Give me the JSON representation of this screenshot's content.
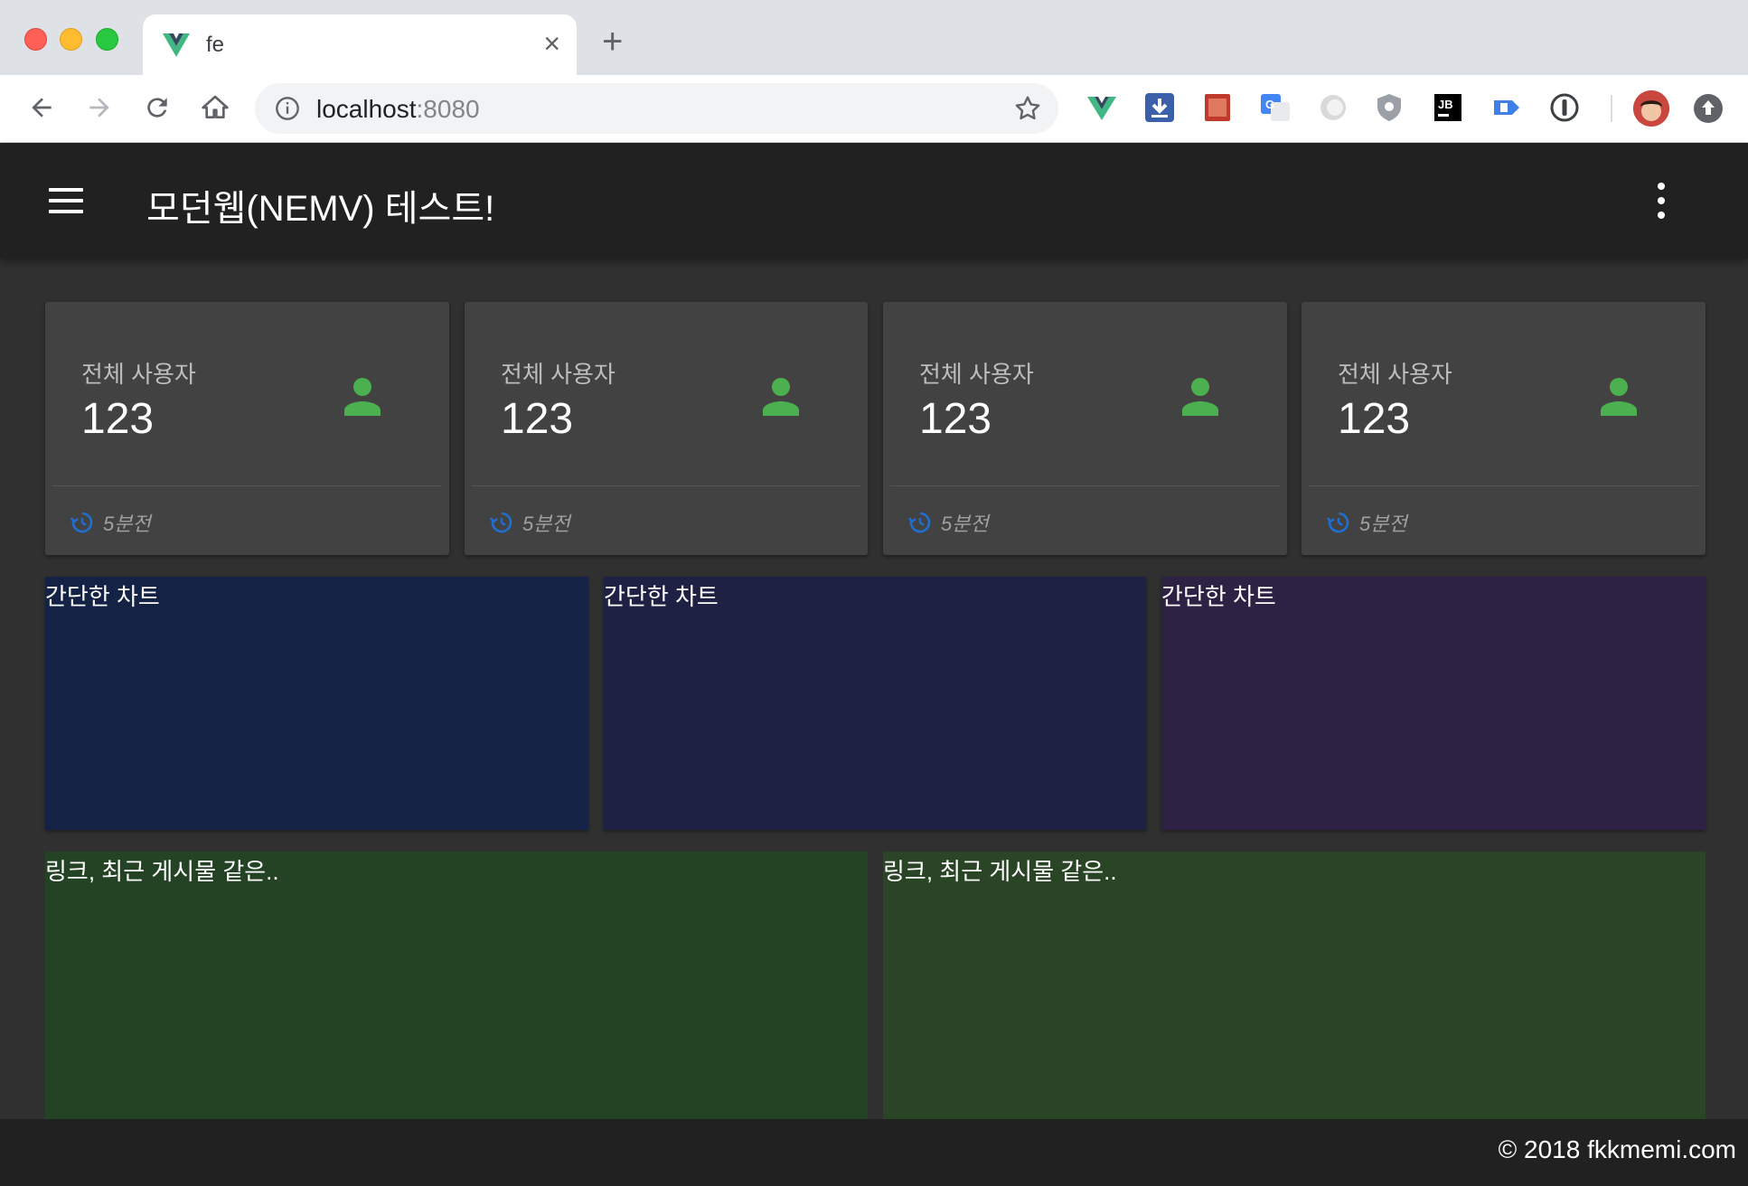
{
  "browser": {
    "tab_title": "fe",
    "tab_close": "×",
    "new_tab": "+",
    "url_host": "localhost",
    "url_port": ":8080"
  },
  "app": {
    "title": "모던웹(NEMV) 테스트!",
    "accent_color": "#4caf50",
    "refresh_color": "#1e6fd0"
  },
  "stats": [
    {
      "label": "전체 사용자",
      "value": "123",
      "footer": "5분전",
      "icon": "person-icon"
    },
    {
      "label": "전체 사용자",
      "value": "123",
      "footer": "5분전",
      "icon": "person-icon"
    },
    {
      "label": "전체 사용자",
      "value": "123",
      "footer": "5분전",
      "icon": "person-icon"
    },
    {
      "label": "전체 사용자",
      "value": "123",
      "footer": "5분전",
      "icon": "person-icon"
    }
  ],
  "charts": [
    {
      "title": "간단한 차트",
      "color": "#132245"
    },
    {
      "title": "간단한 차트",
      "color": "#1f2144"
    },
    {
      "title": "간단한 차트",
      "color": "#2e2244"
    }
  ],
  "links": [
    {
      "title": "링크, 최근 게시물 같은..",
      "color": "#234324"
    },
    {
      "title": "링크, 최근 게시물 같은..",
      "color": "#2a4426"
    }
  ],
  "footer": {
    "text": "© 2018 fkkmemi.com"
  }
}
